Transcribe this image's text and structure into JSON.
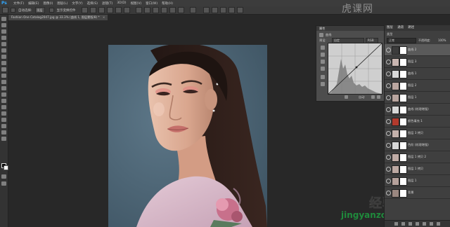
{
  "app": {
    "logo": "Ps"
  },
  "menu": [
    "文件(F)",
    "编辑(E)",
    "图像(I)",
    "图层(L)",
    "文字(Y)",
    "选择(S)",
    "滤镜(T)",
    "3D(D)",
    "视图(V)",
    "窗口(W)",
    "帮助(H)"
  ],
  "options": {
    "auto_select_label": "自动选择:",
    "layer_option": "图层",
    "show_transform_label": "显示变换控件"
  },
  "document": {
    "tab_title": "Fashion One Catalog2047.jpg @ 33.3% (曲线 1, 图层蒙版/8) *",
    "close_glyph": "×"
  },
  "properties": {
    "title": "属性",
    "adjust_label": "曲线",
    "preset_label": "预设:",
    "preset_value": "自定",
    "channel_value": "RGB",
    "auto_label": "自动"
  },
  "layers": {
    "header_tabs": [
      "图层",
      "通道",
      "路径"
    ],
    "kind_label": "类型",
    "blend_mode": "正常",
    "opacity_label": "不透明度:",
    "opacity_value": "100%",
    "items": [
      {
        "name": "曲线 2",
        "thumb": "#3c3c3c"
      },
      {
        "name": "图层 3",
        "thumb": "#c9b6b1"
      },
      {
        "name": "曲线 1",
        "thumb": "#d8d8d8"
      },
      {
        "name": "图层 2",
        "thumb": "#bba6a0"
      },
      {
        "name": "图层 1",
        "thumb": "#b8a49e"
      },
      {
        "name": "曲线 (纹理增强)",
        "thumb": "#d8d8d8"
      },
      {
        "name": "颜色填充 1",
        "thumb": "#b23a2d"
      },
      {
        "name": "图层 3 拷贝",
        "thumb": "#c4b1ab"
      },
      {
        "name": "色阶 (纹理增强)",
        "thumb": "#d8d8d8"
      },
      {
        "name": "图层 1 拷贝 2",
        "thumb": "#c0aca6"
      },
      {
        "name": "图层 1 拷贝",
        "thumb": "#bca8a2"
      },
      {
        "name": "图层 1",
        "thumb": "#b5a19b"
      },
      {
        "name": "背景",
        "thumb": "#9a8780"
      }
    ]
  },
  "watermark": {
    "top": "虎课网",
    "cn": "经验总结",
    "site": "jingyanzongjie.com"
  },
  "colors": {
    "accent": "#31a8ff",
    "photo_bg": "#51697a",
    "site_green": "#1f8a3c"
  }
}
